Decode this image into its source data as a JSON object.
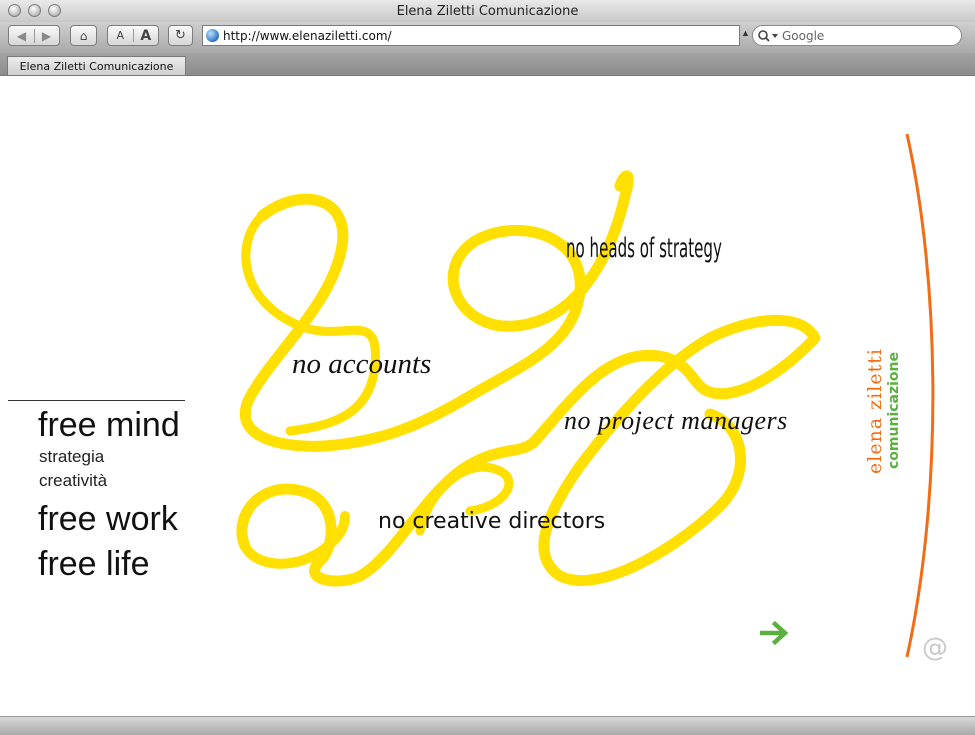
{
  "window": {
    "title": "Elena Ziletti Comunicazione"
  },
  "toolbar": {
    "text_smaller_label": "A",
    "text_bigger_label": "A",
    "url": "http://www.elenaziletti.com/",
    "search_placeholder": "Google"
  },
  "tabs": [
    {
      "label": "Elena Ziletti Comunicazione"
    }
  ],
  "page": {
    "menu": {
      "free_mind": "free mind",
      "strategia": "strategia",
      "creativita": "creatività",
      "free_work": "free work",
      "free_life": "free life"
    },
    "phrases": {
      "heads_of_strategy": "no heads of strategy",
      "accounts": "no accounts",
      "project_managers": "no project managers",
      "creative_directors": "no creative directors"
    },
    "logo": {
      "line1": "elena ziletti",
      "line2": "comunicazione"
    },
    "at_symbol": "@",
    "colors": {
      "ribbon": "#ffe000",
      "orange": "#f36c14",
      "green": "#5bb040"
    }
  }
}
